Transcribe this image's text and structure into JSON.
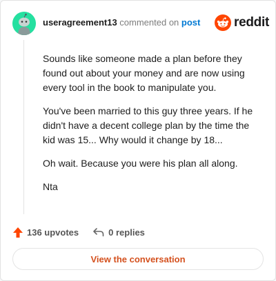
{
  "comment": {
    "username": "useragreement13",
    "action_text": " commented on ",
    "target_link": "post",
    "avatar_icon": "snoo-avatar-icon",
    "paragraphs": [
      "Sounds like someone made a plan before they found out about your money and are now using every tool in the book to manipulate you.",
      "You've been married to this guy three years. If he didn't have a decent college plan by the time the kid was 15... Why would it change by 18...",
      "Oh wait. Because you were his plan all along.",
      "Nta"
    ]
  },
  "brand": {
    "name": "reddit",
    "logo_icon": "reddit-logo-icon",
    "color": "#ff4500"
  },
  "footer": {
    "upvotes": "136 upvotes",
    "upvote_icon": "upvote-arrow-icon",
    "upvote_color": "#ff4500",
    "replies": "0 replies",
    "reply_icon": "reply-arrow-icon"
  },
  "cta": {
    "label": "View the conversation",
    "color": "#d4501d"
  },
  "colors": {
    "avatar_bg": "#25e0a0",
    "link": "#0079d3"
  }
}
